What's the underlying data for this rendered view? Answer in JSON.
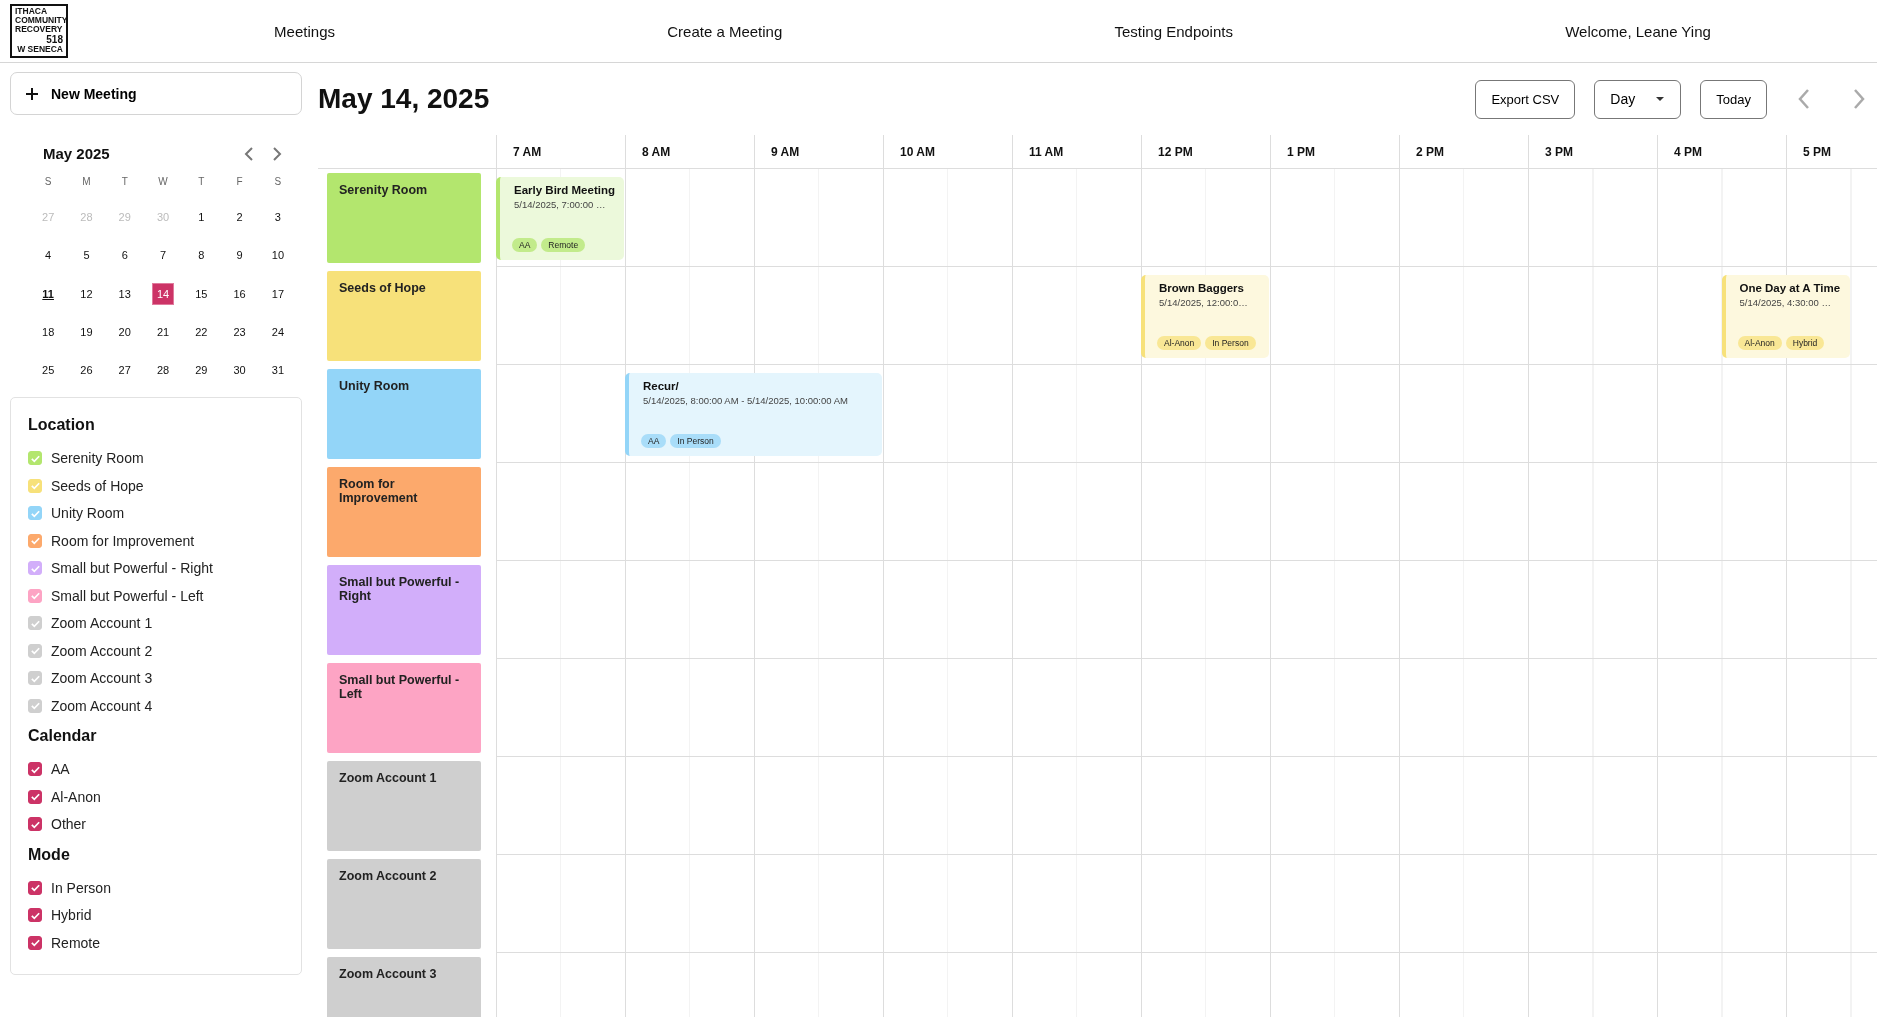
{
  "header": {
    "logo_lines": [
      "ITHACA",
      "COMMUNITY",
      "RECOVERY",
      "518",
      "W SENECA"
    ],
    "nav": [
      "Meetings",
      "Create a Meeting",
      "Testing Endpoints"
    ],
    "welcome": "Welcome, Leane Ying"
  },
  "new_meeting": "New Meeting",
  "mini_calendar": {
    "title": "May 2025",
    "weekdays": [
      "S",
      "M",
      "T",
      "W",
      "T",
      "F",
      "S"
    ],
    "days": [
      {
        "label": "27",
        "muted": true,
        "today": false,
        "selected": false
      },
      {
        "label": "28",
        "muted": true,
        "today": false,
        "selected": false
      },
      {
        "label": "29",
        "muted": true,
        "today": false,
        "selected": false
      },
      {
        "label": "30",
        "muted": true,
        "today": false,
        "selected": false
      },
      {
        "label": "1",
        "muted": false,
        "today": false,
        "selected": false
      },
      {
        "label": "2",
        "muted": false,
        "today": false,
        "selected": false
      },
      {
        "label": "3",
        "muted": false,
        "today": false,
        "selected": false
      },
      {
        "label": "4",
        "muted": false,
        "today": false,
        "selected": false
      },
      {
        "label": "5",
        "muted": false,
        "today": false,
        "selected": false
      },
      {
        "label": "6",
        "muted": false,
        "today": false,
        "selected": false
      },
      {
        "label": "7",
        "muted": false,
        "today": false,
        "selected": false
      },
      {
        "label": "8",
        "muted": false,
        "today": false,
        "selected": false
      },
      {
        "label": "9",
        "muted": false,
        "today": false,
        "selected": false
      },
      {
        "label": "10",
        "muted": false,
        "today": false,
        "selected": false
      },
      {
        "label": "11",
        "muted": false,
        "today": true,
        "selected": false
      },
      {
        "label": "12",
        "muted": false,
        "today": false,
        "selected": false
      },
      {
        "label": "13",
        "muted": false,
        "today": false,
        "selected": false
      },
      {
        "label": "14",
        "muted": false,
        "today": false,
        "selected": true
      },
      {
        "label": "15",
        "muted": false,
        "today": false,
        "selected": false
      },
      {
        "label": "16",
        "muted": false,
        "today": false,
        "selected": false
      },
      {
        "label": "17",
        "muted": false,
        "today": false,
        "selected": false
      },
      {
        "label": "18",
        "muted": false,
        "today": false,
        "selected": false
      },
      {
        "label": "19",
        "muted": false,
        "today": false,
        "selected": false
      },
      {
        "label": "20",
        "muted": false,
        "today": false,
        "selected": false
      },
      {
        "label": "21",
        "muted": false,
        "today": false,
        "selected": false
      },
      {
        "label": "22",
        "muted": false,
        "today": false,
        "selected": false
      },
      {
        "label": "23",
        "muted": false,
        "today": false,
        "selected": false
      },
      {
        "label": "24",
        "muted": false,
        "today": false,
        "selected": false
      },
      {
        "label": "25",
        "muted": false,
        "today": false,
        "selected": false
      },
      {
        "label": "26",
        "muted": false,
        "today": false,
        "selected": false
      },
      {
        "label": "27",
        "muted": false,
        "today": false,
        "selected": false
      },
      {
        "label": "28",
        "muted": false,
        "today": false,
        "selected": false
      },
      {
        "label": "29",
        "muted": false,
        "today": false,
        "selected": false
      },
      {
        "label": "30",
        "muted": false,
        "today": false,
        "selected": false
      },
      {
        "label": "31",
        "muted": false,
        "today": false,
        "selected": false
      }
    ]
  },
  "filters": [
    {
      "title": "Location",
      "items": [
        {
          "label": "Serenity Room",
          "checked": true,
          "color": "#b3e66e"
        },
        {
          "label": "Seeds of Hope",
          "checked": true,
          "color": "#f7e17a"
        },
        {
          "label": "Unity Room",
          "checked": true,
          "color": "#93d5f8"
        },
        {
          "label": "Room for Improvement",
          "checked": true,
          "color": "#fca96c"
        },
        {
          "label": "Small but Powerful - Right",
          "checked": true,
          "color": "#d2aefa"
        },
        {
          "label": "Small but Powerful - Left",
          "checked": true,
          "color": "#fda4c4"
        },
        {
          "label": "Zoom Account 1",
          "checked": true,
          "color": "#cfcfcf"
        },
        {
          "label": "Zoom Account 2",
          "checked": true,
          "color": "#cfcfcf"
        },
        {
          "label": "Zoom Account 3",
          "checked": true,
          "color": "#cfcfcf"
        },
        {
          "label": "Zoom Account 4",
          "checked": true,
          "color": "#cfcfcf"
        }
      ]
    },
    {
      "title": "Calendar",
      "items": [
        {
          "label": "AA",
          "checked": true
        },
        {
          "label": "Al-Anon",
          "checked": true
        },
        {
          "label": "Other",
          "checked": true
        }
      ]
    },
    {
      "title": "Mode",
      "items": [
        {
          "label": "In Person",
          "checked": true
        },
        {
          "label": "Hybrid",
          "checked": true
        },
        {
          "label": "Remote",
          "checked": true
        }
      ]
    }
  ],
  "date_title": "May 14, 2025",
  "toolbar": {
    "export": "Export CSV",
    "view": "Day",
    "today": "Today"
  },
  "hours": [
    "7 AM",
    "8 AM",
    "9 AM",
    "10 AM",
    "11 AM",
    "12 PM",
    "1 PM",
    "2 PM",
    "3 PM",
    "4 PM",
    "5 PM"
  ],
  "rooms": [
    {
      "name": "Serenity Room",
      "color": "#b3e66e",
      "events": [
        {
          "title": "Early Bird Meeting",
          "time": "5/14/2025, 7:00:00 …",
          "tags": [
            "AA",
            "Remote"
          ]
        }
      ]
    },
    {
      "name": "Seeds of Hope",
      "color": "#f7e17a",
      "events": [
        {
          "title": "Brown Baggers",
          "time": "5/14/2025, 12:00:0…",
          "tags": [
            "Al-Anon",
            "In Person"
          ]
        },
        {
          "title": "One Day at A Time",
          "time": "5/14/2025, 4:30:00 …",
          "tags": [
            "Al-Anon",
            "Hybrid"
          ]
        }
      ]
    },
    {
      "name": "Unity Room",
      "color": "#93d5f8",
      "events": [
        {
          "title": "Recur/",
          "time": "5/14/2025, 8:00:00 AM - 5/14/2025, 10:00:00 AM",
          "tags": [
            "AA",
            "In Person"
          ]
        }
      ]
    },
    {
      "name": "Room for Improvement",
      "color": "#fca96c"
    },
    {
      "name": "Small but Powerful - Right",
      "color": "#d2aefa"
    },
    {
      "name": "Small but Powerful - Left",
      "color": "#fda4c4"
    },
    {
      "name": "Zoom Account 1",
      "color": "#cfcfcf"
    },
    {
      "name": "Zoom Account 2",
      "color": "#cfcfcf"
    },
    {
      "name": "Zoom Account 3",
      "color": "#cfcfcf"
    }
  ]
}
